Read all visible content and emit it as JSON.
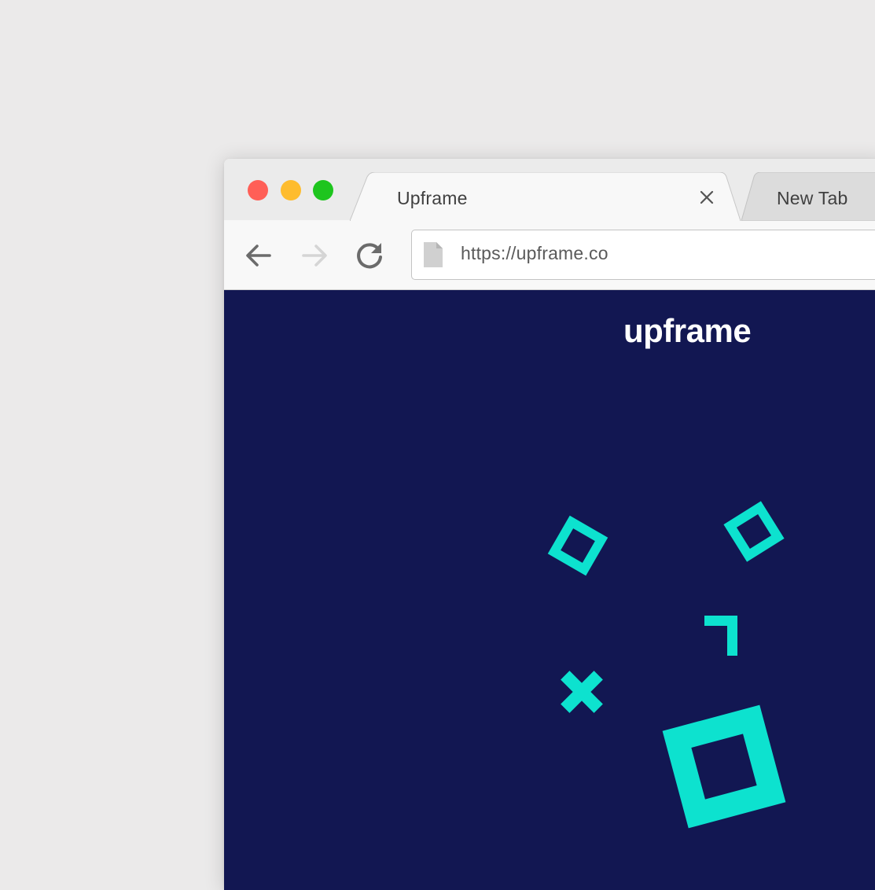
{
  "tabs": {
    "active": {
      "title": "Upframe"
    },
    "inactive": {
      "title": "New Tab"
    }
  },
  "window_controls": {
    "close_color": "#ff5f57",
    "minimize_color": "#febc2e",
    "zoom_color": "#1ec51e"
  },
  "toolbar": {
    "back_icon": "arrow-left-icon",
    "forward_icon": "arrow-right-icon",
    "reload_icon": "reload-icon",
    "forward_enabled": false
  },
  "address_bar": {
    "url": "https://upframe.co",
    "page_icon": "document-icon"
  },
  "page": {
    "brand": "upframe",
    "background_color": "#121752",
    "accent_color": "#0de2cf",
    "decorations": [
      "diamond-outline-shape",
      "diamond-outline-shape",
      "corner-bracket-shape",
      "cross-shape",
      "square-outline-shape"
    ]
  }
}
